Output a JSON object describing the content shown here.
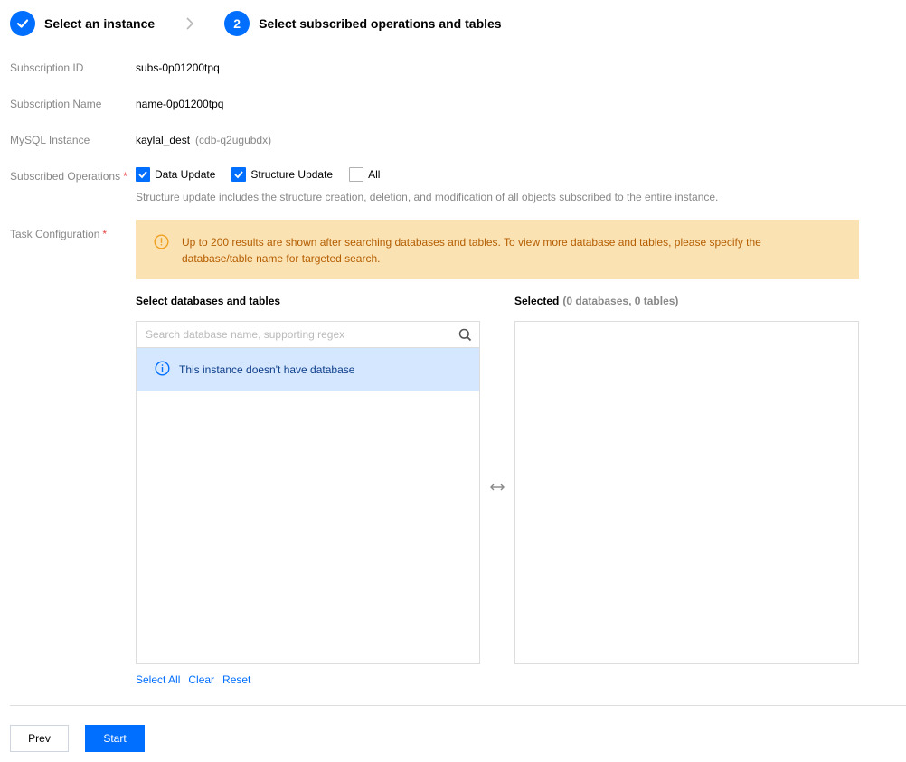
{
  "stepper": {
    "step1": {
      "label": "Select an instance",
      "state": "done"
    },
    "step2": {
      "number": "2",
      "label": "Select subscribed operations and tables",
      "state": "current"
    }
  },
  "form": {
    "subscription_id": {
      "label": "Subscription ID",
      "value": "subs-0p01200tpq"
    },
    "subscription_name": {
      "label": "Subscription Name",
      "value": "name-0p01200tpq"
    },
    "mysql_instance": {
      "label": "MySQL Instance",
      "value": "kaylal_dest",
      "id": "(cdb-q2ugubdx)"
    },
    "subscribed_operations": {
      "label": "Subscribed Operations",
      "required_mark": "*",
      "options": [
        {
          "label": "Data Update",
          "checked": true
        },
        {
          "label": "Structure Update",
          "checked": true
        },
        {
          "label": "All",
          "checked": false
        }
      ],
      "hint": "Structure update includes the structure creation, deletion, and modification of all objects subscribed to the entire instance."
    },
    "task_configuration": {
      "label": "Task Configuration",
      "required_mark": "*"
    }
  },
  "alert": {
    "text": "Up to 200 results are shown after searching databases and tables. To view more database and tables, please specify the database/table name for targeted search."
  },
  "left_panel": {
    "title": "Select databases and tables",
    "search_placeholder": "Search database name, supporting regex",
    "empty_message": "This instance doesn't have database"
  },
  "right_panel": {
    "title": "Selected",
    "count": "(0 databases, 0 tables)"
  },
  "links": {
    "select_all": "Select All",
    "clear": "Clear",
    "reset": "Reset"
  },
  "buttons": {
    "prev": "Prev",
    "start": "Start"
  },
  "colors": {
    "accent": "#006eff",
    "alert_bg": "#fbe2b3",
    "alert_text": "#b35d00",
    "info_bg": "#d5e7ff"
  }
}
